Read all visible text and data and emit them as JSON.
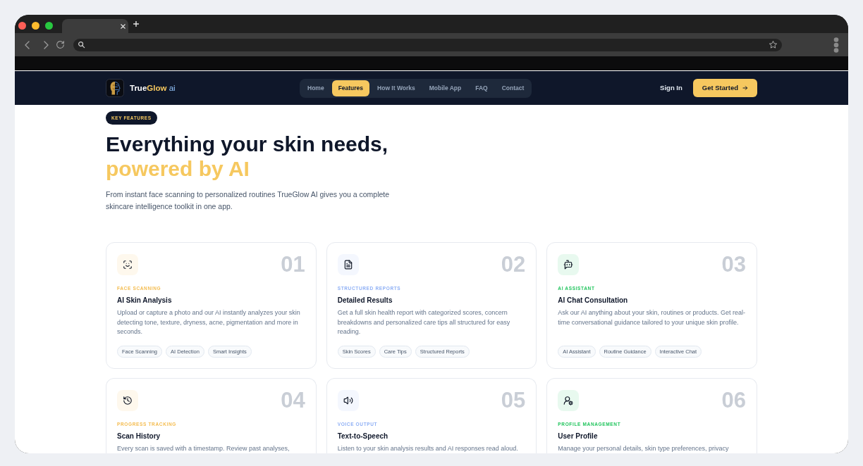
{
  "nav": {
    "brand": {
      "primary": "True",
      "accent": "Glow",
      "suffix": "ai"
    },
    "links": [
      {
        "label": "Home",
        "selected": false
      },
      {
        "label": "Features",
        "selected": true
      },
      {
        "label": "How It Works",
        "selected": false
      },
      {
        "label": "Mobile App",
        "selected": false
      },
      {
        "label": "FAQ",
        "selected": false
      },
      {
        "label": "Contact",
        "selected": false
      }
    ],
    "sign_in": "Sign In",
    "cta": "Get Started"
  },
  "hero": {
    "badge": "KEY FEATURES",
    "title": "Everything your skin needs,",
    "title_highlight": "powered by AI",
    "description": "From instant face scanning to personalized routines TrueGlow AI gives you a complete skincare intelligence toolkit in one app."
  },
  "features": [
    {
      "number": "01",
      "category": "FACE SCANNING",
      "color": "#f4bd52",
      "title": "AI Skin Analysis",
      "description": "Upload or capture a photo and our AI instantly analyzes your skin detecting tone, texture, dryness, acne, pigmentation and more in seconds.",
      "tags": [
        "Face Scanning",
        "AI Detection",
        "Smart Insights"
      ]
    },
    {
      "number": "02",
      "category": "STRUCTURED REPORTS",
      "color": "#8fb0f5",
      "title": "Detailed Results",
      "description": "Get a full skin health report with categorized scores, concern breakdowns and personalized care tips all structured for easy reading.",
      "tags": [
        "Skin Scores",
        "Care Tips",
        "Structured Reports"
      ]
    },
    {
      "number": "03",
      "category": "AI ASSISTANT",
      "color": "#22c55e",
      "title": "AI Chat Consultation",
      "description": "Ask our AI anything about your skin, routines or products. Get real-time conversational guidance tailored to your unique skin profile.",
      "tags": [
        "AI Assistant",
        "Routine Guidance",
        "Interactive Chat"
      ]
    },
    {
      "number": "04",
      "category": "PROGRESS TRACKING",
      "color": "#f4bd52",
      "title": "Scan History",
      "description": "Every scan is saved with a timestamp. Review past analyses,"
    },
    {
      "number": "05",
      "category": "VOICE OUTPUT",
      "color": "#8fb0f5",
      "title": "Text-to-Speech",
      "description": "Listen to your skin analysis results and AI responses read aloud."
    },
    {
      "number": "06",
      "category": "PROFILE MANAGEMENT",
      "color": "#22c55e",
      "title": "User Profile",
      "description": "Manage your personal details, skin type preferences, privacy"
    }
  ]
}
